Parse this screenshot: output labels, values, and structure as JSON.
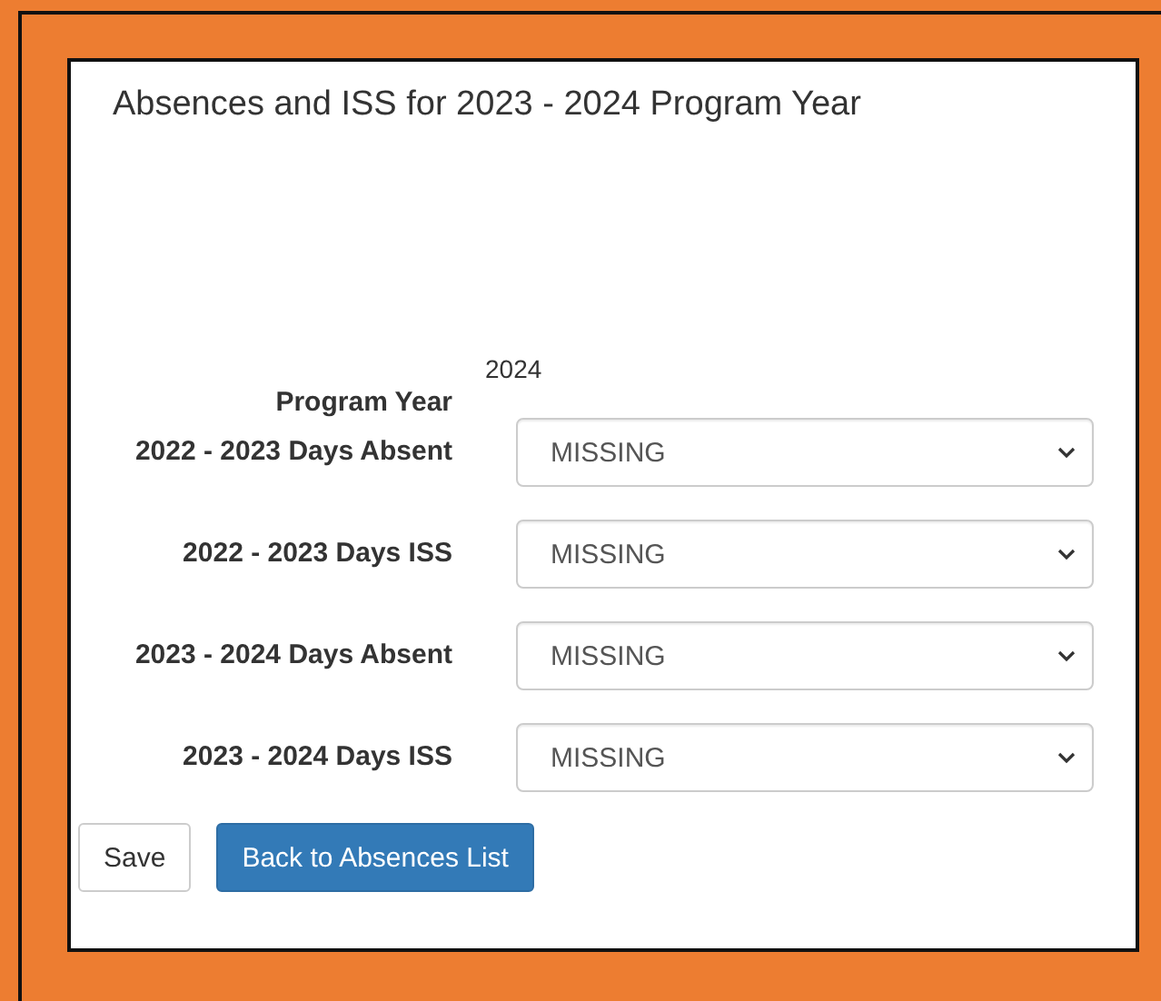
{
  "panel": {
    "title": "Absences and ISS for 2023 - 2024 Program Year"
  },
  "program_year": {
    "label": "Program Year",
    "value": "2024"
  },
  "fields": [
    {
      "label": "2022 - 2023 Days Absent",
      "value": "MISSING"
    },
    {
      "label": "2022 - 2023 Days ISS",
      "value": "MISSING"
    },
    {
      "label": "2023 - 2024 Days Absent",
      "value": "MISSING"
    },
    {
      "label": "2023 - 2024 Days ISS",
      "value": "MISSING"
    }
  ],
  "buttons": [
    {
      "label": "Save",
      "kind": "default"
    },
    {
      "label": "Back to Absences List",
      "kind": "primary"
    }
  ]
}
